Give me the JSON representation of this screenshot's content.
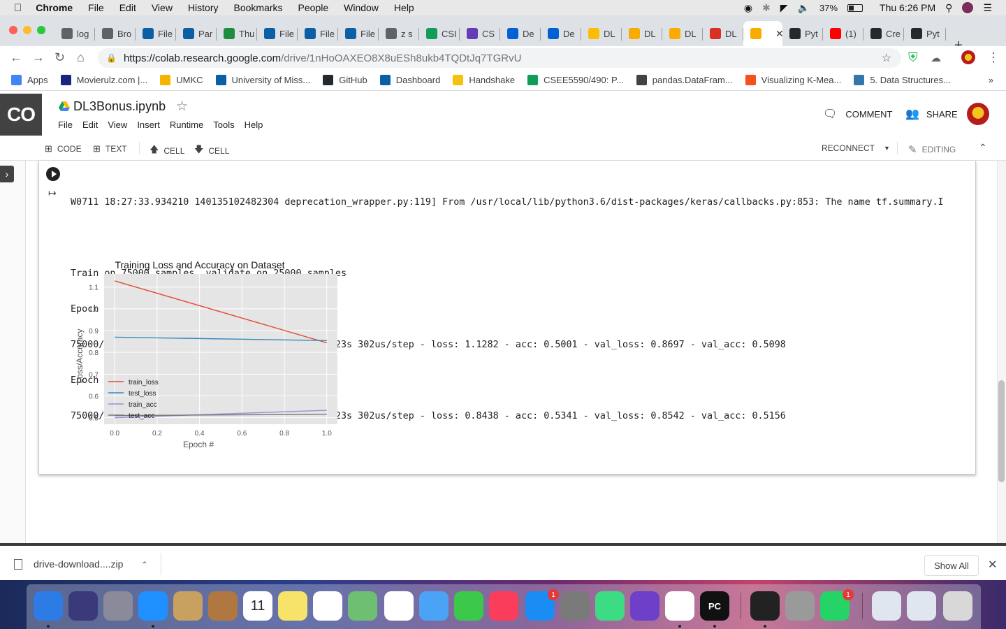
{
  "menubar": {
    "app": "Chrome",
    "items": [
      "File",
      "Edit",
      "View",
      "History",
      "Bookmarks",
      "People",
      "Window",
      "Help"
    ],
    "battery": "37%",
    "clock": "Thu 6:26 PM"
  },
  "tabs": [
    {
      "label": "log",
      "icon": "history-icon",
      "color": "#5f6368"
    },
    {
      "label": "Bro",
      "icon": "globe-icon",
      "color": "#5f6368"
    },
    {
      "label": "File",
      "icon": "umkc-icon",
      "color": "#0b5fa5"
    },
    {
      "label": "Par",
      "icon": "umkc-icon",
      "color": "#0b5fa5"
    },
    {
      "label": "Thu",
      "icon": "drive-icon",
      "color": "#1e8e3e"
    },
    {
      "label": "File",
      "icon": "umkc-icon",
      "color": "#0b5fa5"
    },
    {
      "label": "File",
      "icon": "umkc-icon",
      "color": "#0b5fa5"
    },
    {
      "label": "File",
      "icon": "umkc-icon",
      "color": "#0b5fa5"
    },
    {
      "label": "z s",
      "icon": "gauge-icon",
      "color": "#5f6368"
    },
    {
      "label": "CSI",
      "icon": "sheets-icon",
      "color": "#0f9d58"
    },
    {
      "label": "CS",
      "icon": "forms-icon",
      "color": "#673ab7"
    },
    {
      "label": "De",
      "icon": "box-icon",
      "color": "#0061d5"
    },
    {
      "label": "De",
      "icon": "box-icon",
      "color": "#0061d5"
    },
    {
      "label": "DL",
      "icon": "drive-icon",
      "color": "#fbbc04"
    },
    {
      "label": "DL",
      "icon": "colab-icon",
      "color": "#f9ab00"
    },
    {
      "label": "DL",
      "icon": "colab-icon",
      "color": "#f9ab00"
    },
    {
      "label": "DL",
      "icon": "colab-icon",
      "color": "#d93025"
    },
    {
      "label": "",
      "icon": "colab-icon",
      "color": "#f9ab00",
      "active": true
    },
    {
      "label": "Pyt",
      "icon": "github-icon",
      "color": "#24292e"
    },
    {
      "label": "(1)",
      "icon": "youtube-icon",
      "color": "#ff0000"
    },
    {
      "label": "Cre",
      "icon": "github-icon",
      "color": "#24292e"
    },
    {
      "label": "Pyt",
      "icon": "github-icon",
      "color": "#24292e"
    }
  ],
  "url": {
    "host": "https://colab.research.google.com",
    "path": "/drive/1nHoOAXEO8X8uESh8ukb4TQDtJq7TGRvU"
  },
  "bookmarks": [
    {
      "label": "Apps",
      "color": "#4285f4"
    },
    {
      "label": "Movierulz.com |...",
      "color": "#1a237e"
    },
    {
      "label": "UMKC",
      "color": "#f4b400"
    },
    {
      "label": "University of Miss...",
      "color": "#0b5fa5"
    },
    {
      "label": "GitHub",
      "color": "#24292e"
    },
    {
      "label": "Dashboard",
      "color": "#0b5fa5"
    },
    {
      "label": "Handshake",
      "color": "#f4c20d"
    },
    {
      "label": "CSEE5590/490: P...",
      "color": "#0f9d58"
    },
    {
      "label": "pandas.DataFram...",
      "color": "#424242"
    },
    {
      "label": "Visualizing K-Mea...",
      "color": "#f4511e"
    },
    {
      "label": "5. Data Structures...",
      "color": "#3776ab"
    }
  ],
  "colab": {
    "logo": "CO",
    "title": "DL3Bonus.ipynb",
    "menu": [
      "File",
      "Edit",
      "View",
      "Insert",
      "Runtime",
      "Tools",
      "Help"
    ],
    "comment_label": "COMMENT",
    "share_label": "SHARE",
    "toolbar": {
      "code": "CODE",
      "text": "TEXT",
      "cell_up": "CELL",
      "cell_down": "CELL",
      "reconnect": "RECONNECT",
      "editing": "EDITING"
    }
  },
  "output": {
    "lines": [
      "W0711 18:27:33.934210 140135102482304 deprecation_wrapper.py:119] From /usr/local/lib/python3.6/dist-packages/keras/callbacks.py:853: The name tf.summary.I",
      "",
      "Train on 75000 samples, validate on 25000 samples",
      "Epoch 1/2",
      "75000/75000 [==============================] - 23s 302us/step - loss: 1.1282 - acc: 0.5001 - val_loss: 0.8697 - val_acc: 0.5098",
      "Epoch 2/2",
      "75000/75000 [==============================] - 23s 302us/step - loss: 0.8438 - acc: 0.5341 - val_loss: 0.8542 - val_acc: 0.5156"
    ]
  },
  "chart_data": {
    "type": "line",
    "title": "Training Loss and Accuracy on Dataset",
    "xlabel": "Epoch #",
    "ylabel": "Loss/Accuracy",
    "x": [
      0.0,
      1.0
    ],
    "xticks": [
      "0.0",
      "0.2",
      "0.4",
      "0.6",
      "0.8",
      "1.0"
    ],
    "yticks": [
      "0.5",
      "0.6",
      "0.7",
      "0.8",
      "0.9",
      "1.0",
      "1.1"
    ],
    "xlim": [
      -0.05,
      1.05
    ],
    "ylim": [
      0.47,
      1.16
    ],
    "grid": true,
    "legend": "lower-left",
    "series": [
      {
        "name": "train_loss",
        "values": [
          1.1282,
          0.8438
        ],
        "color": "#e24a33"
      },
      {
        "name": "test_loss",
        "values": [
          0.8697,
          0.8542
        ],
        "color": "#348abd"
      },
      {
        "name": "train_acc",
        "values": [
          0.5001,
          0.5341
        ],
        "color": "#988ed5"
      },
      {
        "name": "test_acc",
        "values": [
          0.5098,
          0.5156
        ],
        "color": "#777777"
      }
    ]
  },
  "download": {
    "filename": "drive-download....zip",
    "show_all": "Show All"
  },
  "dock": [
    {
      "name": "finder",
      "color": "#2d7be5"
    },
    {
      "name": "siri",
      "color": "#3a3a7a"
    },
    {
      "name": "launchpad",
      "color": "#8a8a9a"
    },
    {
      "name": "safari",
      "color": "#1e90ff"
    },
    {
      "name": "mail-stamp",
      "color": "#c8a060"
    },
    {
      "name": "contacts",
      "color": "#b07840"
    },
    {
      "name": "calendar",
      "color": "#ffffff",
      "text": "11"
    },
    {
      "name": "notes",
      "color": "#f7e36a"
    },
    {
      "name": "reminders",
      "color": "#ffffff"
    },
    {
      "name": "maps",
      "color": "#6fbf73"
    },
    {
      "name": "photos",
      "color": "#ffffff"
    },
    {
      "name": "messages",
      "color": "#4aa3f5"
    },
    {
      "name": "facetime",
      "color": "#3cc84a"
    },
    {
      "name": "music",
      "color": "#fa3d5b"
    },
    {
      "name": "app-store",
      "color": "#1c8cf5",
      "badge": "1"
    },
    {
      "name": "system-preferences",
      "color": "#7a7a7a"
    },
    {
      "name": "android-studio",
      "color": "#3ddc84"
    },
    {
      "name": "github-desktop",
      "color": "#6e40c9"
    },
    {
      "name": "chrome",
      "color": "#ffffff"
    },
    {
      "name": "pycharm",
      "color": "#111111",
      "text": "PC"
    },
    {
      "name": "terminal",
      "color": "#222222"
    },
    {
      "name": "calculator",
      "color": "#9a9a9a"
    },
    {
      "name": "whatsapp",
      "color": "#25d366",
      "badge": "1"
    },
    {
      "name": "documents",
      "color": "#e0e6f0"
    },
    {
      "name": "downloads",
      "color": "#e0e6f0"
    },
    {
      "name": "trash",
      "color": "#d8d8d8"
    }
  ]
}
